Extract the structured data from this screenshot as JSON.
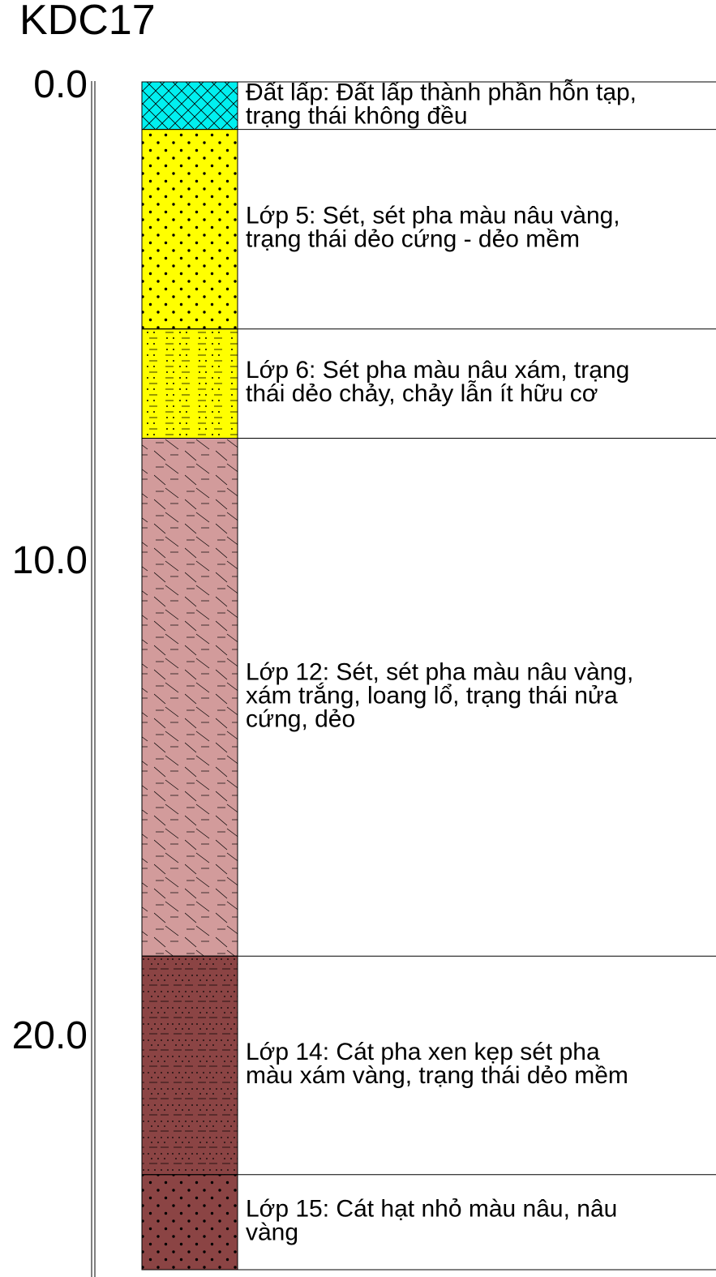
{
  "title": "KDC17",
  "depth_scale": {
    "labels": [
      "0.0",
      "10.0",
      "20.0"
    ],
    "values": [
      0,
      10,
      20
    ]
  },
  "layers": [
    {
      "top": 0,
      "bottom": 1.0,
      "pattern": "crosshatch",
      "color": "#00F0F0",
      "description": [
        "Đất lấp: Đất lấp thành phần hỗn tạp,",
        "trạng thái không đều"
      ]
    },
    {
      "top": 1.0,
      "bottom": 5.2,
      "pattern": "dots",
      "color": "#FFFF00",
      "description": [
        "Lớp 5: Sét, sét pha màu nâu vàng,",
        "trạng thái dẻo cứng - dẻo mềm"
      ]
    },
    {
      "top": 5.2,
      "bottom": 7.5,
      "pattern": "dots-dashes",
      "color": "#FFFF00",
      "description": [
        "Lớp 6: Sét pha màu nâu xám, trạng",
        "thái dẻo chảy, chảy lẫn ít hữu cơ"
      ]
    },
    {
      "top": 7.5,
      "bottom": 18.4,
      "pattern": "diagonal-dashes",
      "color": "#D29B9B",
      "description": [
        "Lớp 12: Sét, sét pha màu nâu vàng,",
        "xám trắng, loang lổ, trạng thái nửa",
        "cứng, dẻo"
      ]
    },
    {
      "top": 18.4,
      "bottom": 23.0,
      "pattern": "fine-dots-dashes",
      "color": "#8B4444",
      "description": [
        "Lớp 14: Cát pha xen kẹp sét pha",
        "màu xám vàng, trạng thái dẻo mềm"
      ]
    },
    {
      "top": 23.0,
      "bottom": 25.0,
      "pattern": "dots",
      "color": "#8B4444",
      "description": [
        "Lớp 15: Cát hạt nhỏ màu nâu, nâu",
        "vàng"
      ]
    }
  ]
}
